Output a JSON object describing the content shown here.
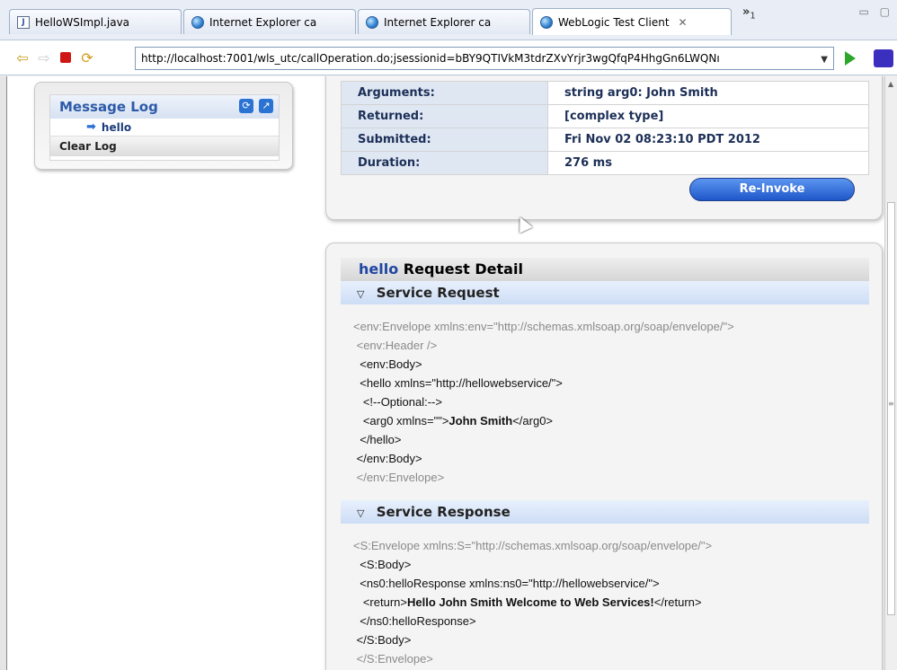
{
  "tabs": [
    {
      "label": "HelloWSImpl.java",
      "icon": "java-file-icon"
    },
    {
      "label": "Internet Explorer ca",
      "icon": "globe-icon"
    },
    {
      "label": "Internet Explorer ca",
      "icon": "globe-icon"
    },
    {
      "label": "WebLogic Test Client",
      "icon": "globe-icon",
      "active": true
    }
  ],
  "tab_overflow": {
    "glyph": "»",
    "count": "1"
  },
  "address_bar": {
    "url": "http://localhost:7001/wls_utc/callOperation.do;jsessionid=bBY9QTIVkM3tdrZXvYrjr3wgQfqP4HhgGn6LWQNı"
  },
  "message_log": {
    "title": "Message Log",
    "items": [
      "hello"
    ],
    "clear_label": "Clear Log"
  },
  "result": {
    "rows": [
      {
        "label": "Arguments:",
        "value": "string arg0: John Smith"
      },
      {
        "label": "Returned:",
        "value": "[complex type]"
      },
      {
        "label": "Submitted:",
        "value": "Fri Nov 02 08:23:10 PDT 2012"
      },
      {
        "label": "Duration:",
        "value": "276 ms"
      }
    ],
    "reinvoke_label": "Re-Invoke"
  },
  "detail": {
    "operation": "hello",
    "title_rest": "Request Detail",
    "request_header": "Service Request",
    "response_header": "Service Response",
    "request_lines": [
      "<env:Envelope xmlns:env=\"http://schemas.xmlsoap.org/soap/envelope/\">",
      " <env:Header />",
      "  <env:Body>",
      "  <hello xmlns=\"http://hellowebservice/\">",
      "   <!--Optional:-->",
      "   <arg0 xmlns=\"\">",
      "  </hello>",
      " </env:Body>",
      " </env:Envelope>"
    ],
    "request_arg_value": "John Smith",
    "request_arg_close": "</arg0>",
    "response_lines": [
      "<S:Envelope xmlns:S=\"http://schemas.xmlsoap.org/soap/envelope/\">",
      "  <S:Body>",
      "  <ns0:helloResponse xmlns:ns0=\"http://hellowebservice/\">",
      "   <return>",
      "  </ns0:helloResponse>",
      " </S:Body>",
      " </S:Envelope>"
    ],
    "response_return_value": "Hello John Smith Welcome to Web Services!",
    "response_return_close": "</return>"
  }
}
